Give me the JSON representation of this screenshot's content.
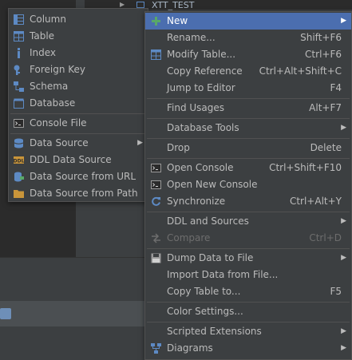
{
  "background": {
    "tree_label": "XTT_TEST"
  },
  "submenu": {
    "items": [
      {
        "label": "Column",
        "icon": "column-icon"
      },
      {
        "label": "Table",
        "icon": "table-icon"
      },
      {
        "label": "Index",
        "icon": "index-icon"
      },
      {
        "label": "Foreign Key",
        "icon": "key-icon"
      },
      {
        "label": "Schema",
        "icon": "schema-icon"
      },
      {
        "label": "Database",
        "icon": "database-icon"
      },
      {
        "label": "Console File",
        "icon": "console-file-icon"
      },
      {
        "label": "Data Source",
        "icon": "data-source-icon",
        "submenu": true
      },
      {
        "label": "DDL Data Source",
        "icon": "ddl-icon"
      },
      {
        "label": "Data Source from URL",
        "icon": "data-source-url-icon"
      },
      {
        "label": "Data Source from Path",
        "icon": "folder-icon"
      }
    ]
  },
  "context_menu": {
    "items": [
      {
        "label": "New",
        "shortcut": "",
        "submenu": true,
        "highlighted": true
      },
      {
        "label": "Rename...",
        "shortcut": "Shift+F6"
      },
      {
        "label": "Modify Table...",
        "shortcut": "Ctrl+F6",
        "icon": "modify-table-icon"
      },
      {
        "label": "Copy Reference",
        "shortcut": "Ctrl+Alt+Shift+C"
      },
      {
        "label": "Jump to Editor",
        "shortcut": "F4"
      },
      {
        "label": "Find Usages",
        "shortcut": "Alt+F7"
      },
      {
        "label": "Database Tools",
        "submenu": true
      },
      {
        "label": "Drop",
        "shortcut": "Delete"
      },
      {
        "label": "Open Console",
        "shortcut": "Ctrl+Shift+F10",
        "icon": "console-icon"
      },
      {
        "label": "Open New Console",
        "icon": "console-icon"
      },
      {
        "label": "Synchronize",
        "shortcut": "Ctrl+Alt+Y",
        "icon": "sync-icon"
      },
      {
        "label": "DDL and Sources",
        "submenu": true
      },
      {
        "label": "Compare",
        "shortcut": "Ctrl+D",
        "disabled": true,
        "icon": "compare-icon"
      },
      {
        "label": "Dump Data to File",
        "submenu": true,
        "icon": "dump-icon"
      },
      {
        "label": "Import Data from File..."
      },
      {
        "label": "Copy Table to...",
        "shortcut": "F5"
      },
      {
        "label": "Color Settings..."
      },
      {
        "label": "Scripted Extensions",
        "submenu": true
      },
      {
        "label": "Diagrams",
        "submenu": true,
        "icon": "diagram-icon"
      }
    ]
  },
  "colors": {
    "menu_bg": "#3c3f41",
    "highlight": "#4b6eaf",
    "text": "#bbbbbb",
    "disabled_text": "#6d6d6d",
    "accent_green": "#59a869",
    "accent_blue": "#5d8ac4"
  }
}
